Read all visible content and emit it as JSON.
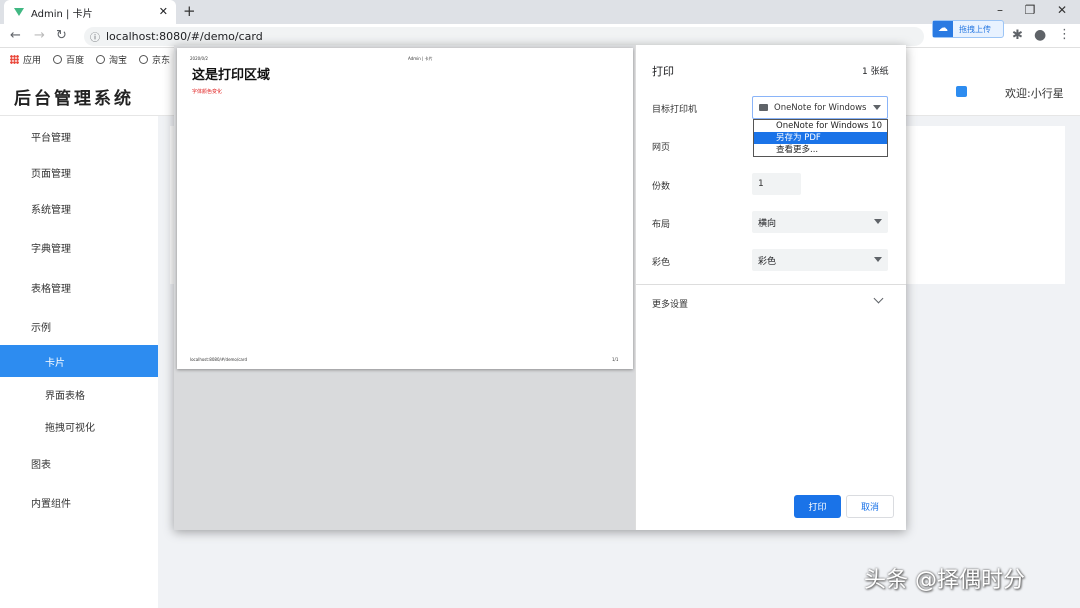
{
  "browser": {
    "tab_title": "Admin | 卡片",
    "url": "localhost:8080/#/demo/card",
    "bookmarks": [
      "应用",
      "百度",
      "淘宝",
      "京东"
    ],
    "baidu_upload": "拖拽上传"
  },
  "app": {
    "title": "后台管理系统",
    "welcome": "欢迎:小行星",
    "sidebar": [
      {
        "label": "平台管理"
      },
      {
        "label": "页面管理"
      },
      {
        "label": "系统管理"
      },
      {
        "label": "字典管理"
      },
      {
        "label": "表格管理"
      },
      {
        "label": "示例"
      },
      {
        "label": "卡片",
        "active": true
      },
      {
        "label": "界面表格"
      },
      {
        "label": "拖拽可视化"
      },
      {
        "label": "图表"
      },
      {
        "label": "内置组件"
      }
    ]
  },
  "print_preview": {
    "date": "2020/0/2",
    "header_center": "Admin | 卡片",
    "title": "这是打印区域",
    "note": "字体颜色变化",
    "footer_url": "localhost:8080/#/demo/card",
    "page_num": "1/1"
  },
  "print_settings": {
    "heading": "打印",
    "sheets": "1 张纸",
    "destination_label": "目标打印机",
    "destination_value": "OneNote for Windows",
    "destination_options": [
      "OneNote for Windows 10",
      "另存为 PDF",
      "查看更多..."
    ],
    "pages_label": "网页",
    "copies_label": "份数",
    "copies_value": "1",
    "layout_label": "布局",
    "layout_value": "横向",
    "color_label": "彩色",
    "color_value": "彩色",
    "more_settings": "更多设置",
    "print_button": "打印",
    "cancel_button": "取消"
  },
  "watermark": "头条 @择偶时分",
  "colors": {
    "accent": "#2d8cf0",
    "chrome_blue": "#1a73e8"
  }
}
